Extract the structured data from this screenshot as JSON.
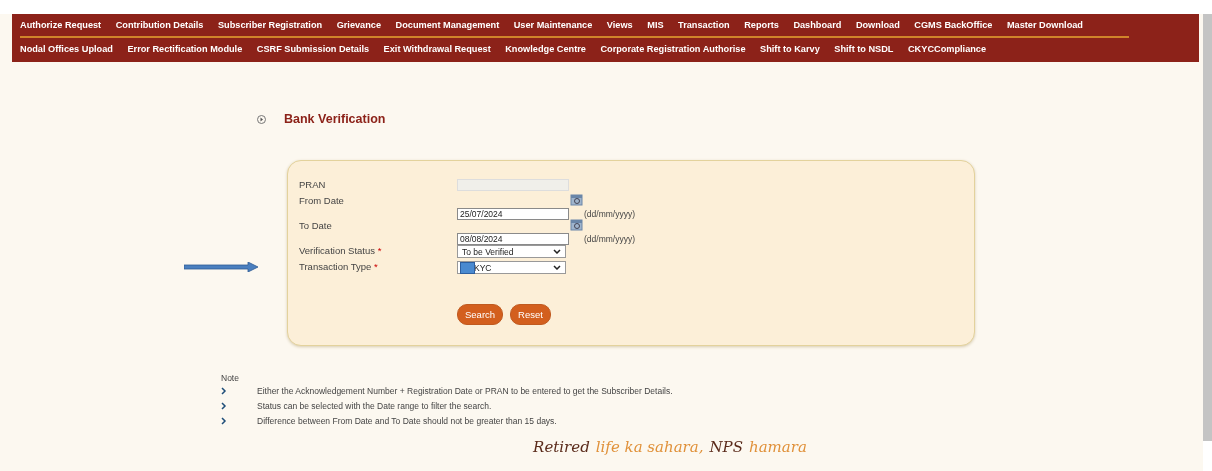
{
  "menu_rows": [
    [
      "Authorize Request",
      "Contribution Details",
      "Subscriber Registration",
      "Grievance",
      "Document Management",
      "User Maintenance",
      "Views",
      "MIS",
      "Transaction",
      "Reports",
      "Dashboard",
      "Download",
      "CGMS BackOffice",
      "Master Download"
    ],
    [
      "Nodal Offices Upload",
      "Error Rectification Module",
      "CSRF Submission Details",
      "Exit Withdrawal Request",
      "Knowledge Centre",
      "Corporate Registration Authorise",
      "Shift to Karvy",
      "Shift to NSDL",
      "CKYCCompliance"
    ]
  ],
  "page_title": "Bank Verification",
  "form": {
    "fields": [
      {
        "kind": "text",
        "label": "PRAN",
        "disabled": true
      },
      {
        "kind": "date",
        "label": "From Date",
        "value": "25/07/2024",
        "hint": "(dd/mm/yyyy)"
      },
      {
        "kind": "date",
        "label": "To Date",
        "value": "08/08/2024",
        "hint": "(dd/mm/yyyy)"
      },
      {
        "kind": "select",
        "label": "Verification Status",
        "required_mark": "*",
        "value": "To be Verified"
      },
      {
        "kind": "select",
        "label": "Transaction Type",
        "required_mark": "*",
        "value": "KYC",
        "redacted": true,
        "pointer_arrow": true
      }
    ],
    "buttons": [
      "Search",
      "Reset"
    ]
  },
  "note": {
    "title": "Note",
    "items": [
      "Either the Acknowledgement Number + Registration Date or PRAN to be entered to get the Subscriber Details.",
      "Status can be selected with the Date range to filter the search.",
      "Difference between From Date and To Date should not be greater than 15 days."
    ]
  },
  "tagline": [
    {
      "text": "Retired",
      "color": "#5a2a1a"
    },
    {
      "text": "life ka sahara,",
      "color": "#e0913a"
    },
    {
      "text": "NPS",
      "color": "#5a2a1a"
    },
    {
      "text": "hamara",
      "color": "#e0913a"
    }
  ]
}
